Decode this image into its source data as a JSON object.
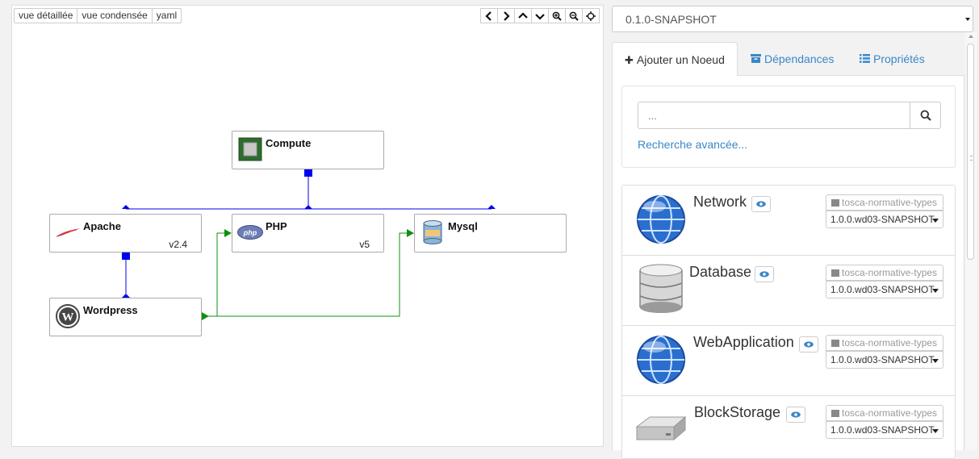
{
  "canvas": {
    "view_buttons": [
      "vue détaillée",
      "vue condensée",
      "yaml"
    ],
    "controls": [
      "chevron-left-icon",
      "chevron-right-icon",
      "chevron-up-icon",
      "chevron-down-icon",
      "zoom-in-icon",
      "zoom-out-icon",
      "crosshairs-icon"
    ],
    "nodes": {
      "compute": {
        "name": "Compute",
        "version": ""
      },
      "apache": {
        "name": "Apache",
        "version": "v2.4"
      },
      "php": {
        "name": "PHP",
        "version": "v5"
      },
      "mysql": {
        "name": "Mysql",
        "version": ""
      },
      "wordpress": {
        "name": "Wordpress",
        "version": ""
      }
    },
    "colors": {
      "hosted_on": "#0000ee",
      "connects_to": "#109010"
    }
  },
  "version_select": {
    "value": "0.1.0-SNAPSHOT"
  },
  "tabs": [
    {
      "label": "Ajouter un Noeud",
      "icon": "plus-icon",
      "active": true
    },
    {
      "label": "Dépendances",
      "icon": "archive-icon",
      "active": false
    },
    {
      "label": "Propriétés",
      "icon": "list-icon",
      "active": false
    }
  ],
  "search": {
    "placeholder": "...",
    "advanced_link": "Recherche avancée..."
  },
  "components": [
    {
      "name": "Network",
      "icon": "globe-icon",
      "repository": "tosca-normative-types",
      "version": "1.0.0.wd03-SNAPSHOT"
    },
    {
      "name": "Database",
      "icon": "database-icon",
      "repository": "tosca-normative-types",
      "version": "1.0.0.wd03-SNAPSHOT"
    },
    {
      "name": "WebApplication",
      "icon": "globe-icon",
      "repository": "tosca-normative-types",
      "version": "1.0.0.wd03-SNAPSHOT"
    },
    {
      "name": "BlockStorage",
      "icon": "harddrive-icon",
      "repository": "tosca-normative-types",
      "version": "1.0.0.wd03-SNAPSHOT"
    }
  ]
}
